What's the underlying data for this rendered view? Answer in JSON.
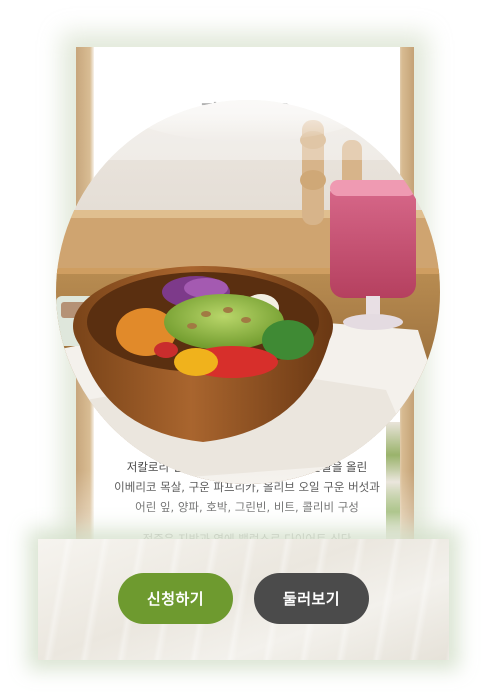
{
  "card": {
    "title": "정오하나요",
    "description_lines": [
      "저칼로리 샐러드에 아보카도와 단백질 달걀을 올린",
      "이베리코 목살, 구운 파프리카, 올리브 오일 구운 버섯과",
      "어린 잎, 양파, 호박, 그린빈, 비트, 콜리비 구성"
    ],
    "note": "적중은 지방과 염에 밸런스로 다이어트 식단"
  },
  "photo": {
    "subject": "salad-bowl-with-smoothie"
  },
  "actions": {
    "apply_label": "신청하기",
    "browse_label": "둘러보기"
  },
  "colors": {
    "apply_button": "#6e9a2f",
    "browse_button": "#4b4b4b",
    "glow": "#d8e2ce",
    "bar_background": "#efece6"
  }
}
